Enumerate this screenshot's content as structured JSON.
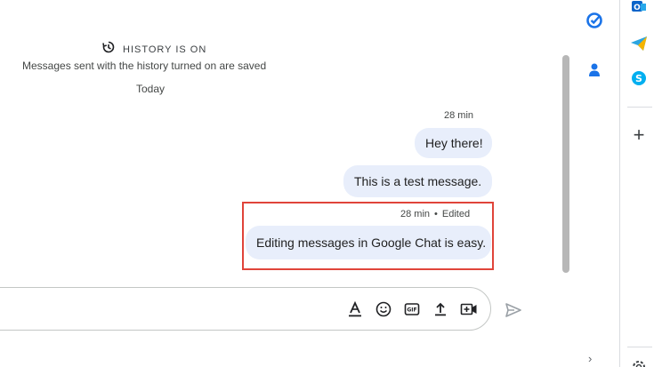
{
  "history": {
    "title": "HISTORY IS ON",
    "subtitle": "Messages sent with the history turned on are saved",
    "date_divider": "Today"
  },
  "messages": [
    {
      "time": "28 min",
      "text": "Hey there!",
      "edited": ""
    },
    {
      "time": "",
      "text": "This is a test message.",
      "edited": ""
    },
    {
      "time": "28 min",
      "text": "Editing messages in Google Chat is easy.",
      "edited": "Edited",
      "separator": "•"
    }
  ],
  "composer": {
    "tools": [
      "format-text-icon",
      "emoji-icon",
      "gif-icon",
      "upload-icon",
      "video-meeting-icon"
    ],
    "gif_label": "GIF"
  },
  "colors": {
    "bubble": "#e8eefb",
    "highlight": "#e0443a",
    "accent_blue": "#1a73e8"
  },
  "rail": {
    "icons": [
      "tasks-icon",
      "contacts-icon"
    ],
    "far_icons": [
      "outlook-icon",
      "telegram-icon",
      "skype-icon",
      "add-icon",
      "settings-icon"
    ],
    "add_label": "+"
  },
  "scroll": {
    "expand_label": "›"
  }
}
